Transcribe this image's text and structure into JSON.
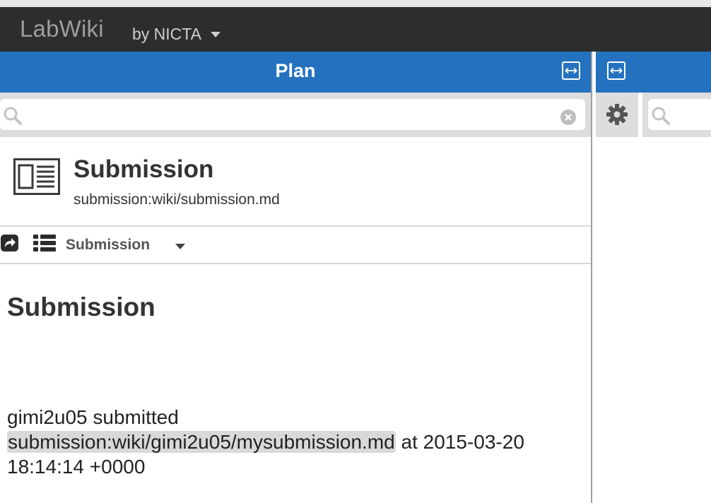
{
  "navbar": {
    "brand": "LabWiki",
    "org": "by NICTA"
  },
  "plan_panel": {
    "title": "Plan",
    "search": {
      "value": "",
      "placeholder": ""
    },
    "card": {
      "title": "Submission",
      "path": "submission:wiki/submission.md"
    },
    "toolbar": {
      "label": "Submission"
    },
    "content": {
      "heading": "Submission",
      "text_before": "gimi2u05 submitted ",
      "code": "submission:wiki/gimi2u05/mysubmission.md",
      "text_after": " at 2015-03-20 18:14:14 +0000"
    }
  },
  "right_panel": {
    "search": {
      "value": "",
      "placeholder": ""
    }
  },
  "icons": [
    "search-icon",
    "clear-icon",
    "expand-icon",
    "document-icon",
    "share-icon",
    "list-icon",
    "gear-icon"
  ],
  "colors": {
    "navbar": "#2d2d2d",
    "title_bar": "#2472bf",
    "search_bg": "#dddddd",
    "code_bg": "#d9d9d9"
  }
}
